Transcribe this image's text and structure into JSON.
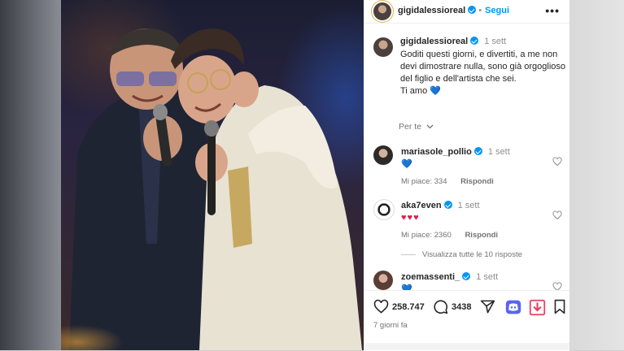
{
  "post": {
    "username": "gigidalessioreal",
    "follow_label": "Segui",
    "more_label": "•••"
  },
  "caption": {
    "username": "gigidalessioreal",
    "time": "1 sett",
    "text": "Goditi questi giorni, e divertiti, a me non devi dimostrare nulla, sono già orgoglioso del figlio e dell'artista che sei.",
    "text2": "Ti amo",
    "text2_emoji": "💙",
    "per_te_label": "Per te"
  },
  "comments": [
    {
      "username": "mariasole_pollio",
      "time": "1 sett",
      "text": "💙",
      "likes": "Mi piace: 334",
      "reply": "Rispondi"
    },
    {
      "username": "aka7even",
      "time": "1 sett",
      "text": "♥♥♥",
      "likes": "Mi piace: 2360",
      "reply": "Rispondi",
      "view_replies": "Visualizza tutte le 10 risposte"
    },
    {
      "username": "zoemassenti_",
      "time": "1 sett",
      "text": "💙"
    }
  ],
  "actions": {
    "likes": "258.747",
    "comments": "3438",
    "posted": "7 giorni fa"
  },
  "colors": {
    "accent": "#0095f6",
    "download_red": "#e4405f",
    "discord_blue": "#5865f2"
  }
}
